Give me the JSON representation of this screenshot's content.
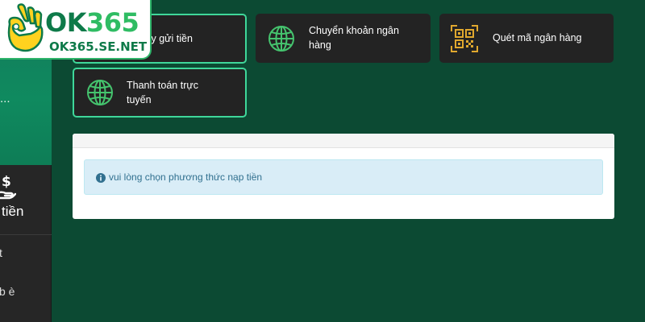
{
  "logo": {
    "title_part1": "OK",
    "title_part2": "365",
    "site": "OK365.SE.NET"
  },
  "sidebar": {
    "overflow_text": "...",
    "deposit": {
      "label": "tiền",
      "icon": "hand-money-icon"
    },
    "items": [
      {
        "label": "t"
      },
      {
        "label": "b è"
      }
    ]
  },
  "payment_methods": [
    {
      "id": "company",
      "label": "ty gửi tiền",
      "icon": "globe-icon",
      "active": true
    },
    {
      "id": "bank_transfer",
      "label_line1": "Chuyển khoản ngân",
      "label_line2": "hàng",
      "icon": "globe-icon",
      "active": false
    },
    {
      "id": "qr",
      "label": "Quét mã ngân hàng",
      "icon": "qr-code-icon",
      "active": false
    },
    {
      "id": "online",
      "label_line1": "Thanh toán trực",
      "label_line2": "tuyến",
      "icon": "globe-icon",
      "active": true
    }
  ],
  "notice": {
    "icon": "info-icon",
    "text": "vui lòng chọn phương thức nạp tiền"
  },
  "colors": {
    "background": "#0c4a33",
    "card": "#232323",
    "active_border": "#3fd79a",
    "globe": "#45c46e",
    "qr": "#e0a82e",
    "alert_bg": "#d9edf7",
    "alert_text": "#31708f"
  }
}
